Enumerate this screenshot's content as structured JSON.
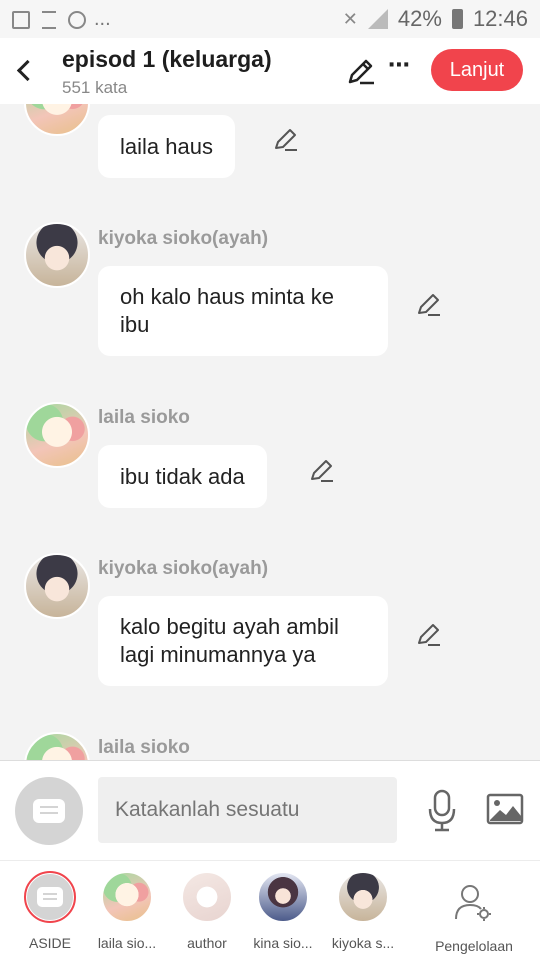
{
  "status_bar": {
    "battery": "42%",
    "time": "12:46",
    "more": "..."
  },
  "header": {
    "title": "episod 1 (keluarga)",
    "word_count": "551 kata",
    "next_button": "Lanjut",
    "more": "⋯"
  },
  "messages": [
    {
      "speaker": "",
      "text": "laila haus",
      "avatar": "laila"
    },
    {
      "speaker": "kiyoka sioko(ayah)",
      "text": "oh kalo haus minta ke ibu",
      "avatar": "kiyoka"
    },
    {
      "speaker": "laila sioko",
      "text": "ibu tidak ada",
      "avatar": "laila"
    },
    {
      "speaker": "kiyoka sioko(ayah)",
      "text": "kalo begitu ayah ambil lagi minumannya ya",
      "avatar": "kiyoka"
    },
    {
      "speaker": "laila sioko",
      "text": "",
      "avatar": "laila"
    }
  ],
  "composer": {
    "placeholder": "Katakanlah sesuatu"
  },
  "characters": [
    {
      "label": "ASIDE"
    },
    {
      "label": "laila sio..."
    },
    {
      "label": "author"
    },
    {
      "label": "kina sio..."
    },
    {
      "label": "kiyoka s..."
    }
  ],
  "manage_label": "Pengelolaan",
  "colors": {
    "accent": "#f1444c",
    "name_gray": "#9a9a9a"
  }
}
